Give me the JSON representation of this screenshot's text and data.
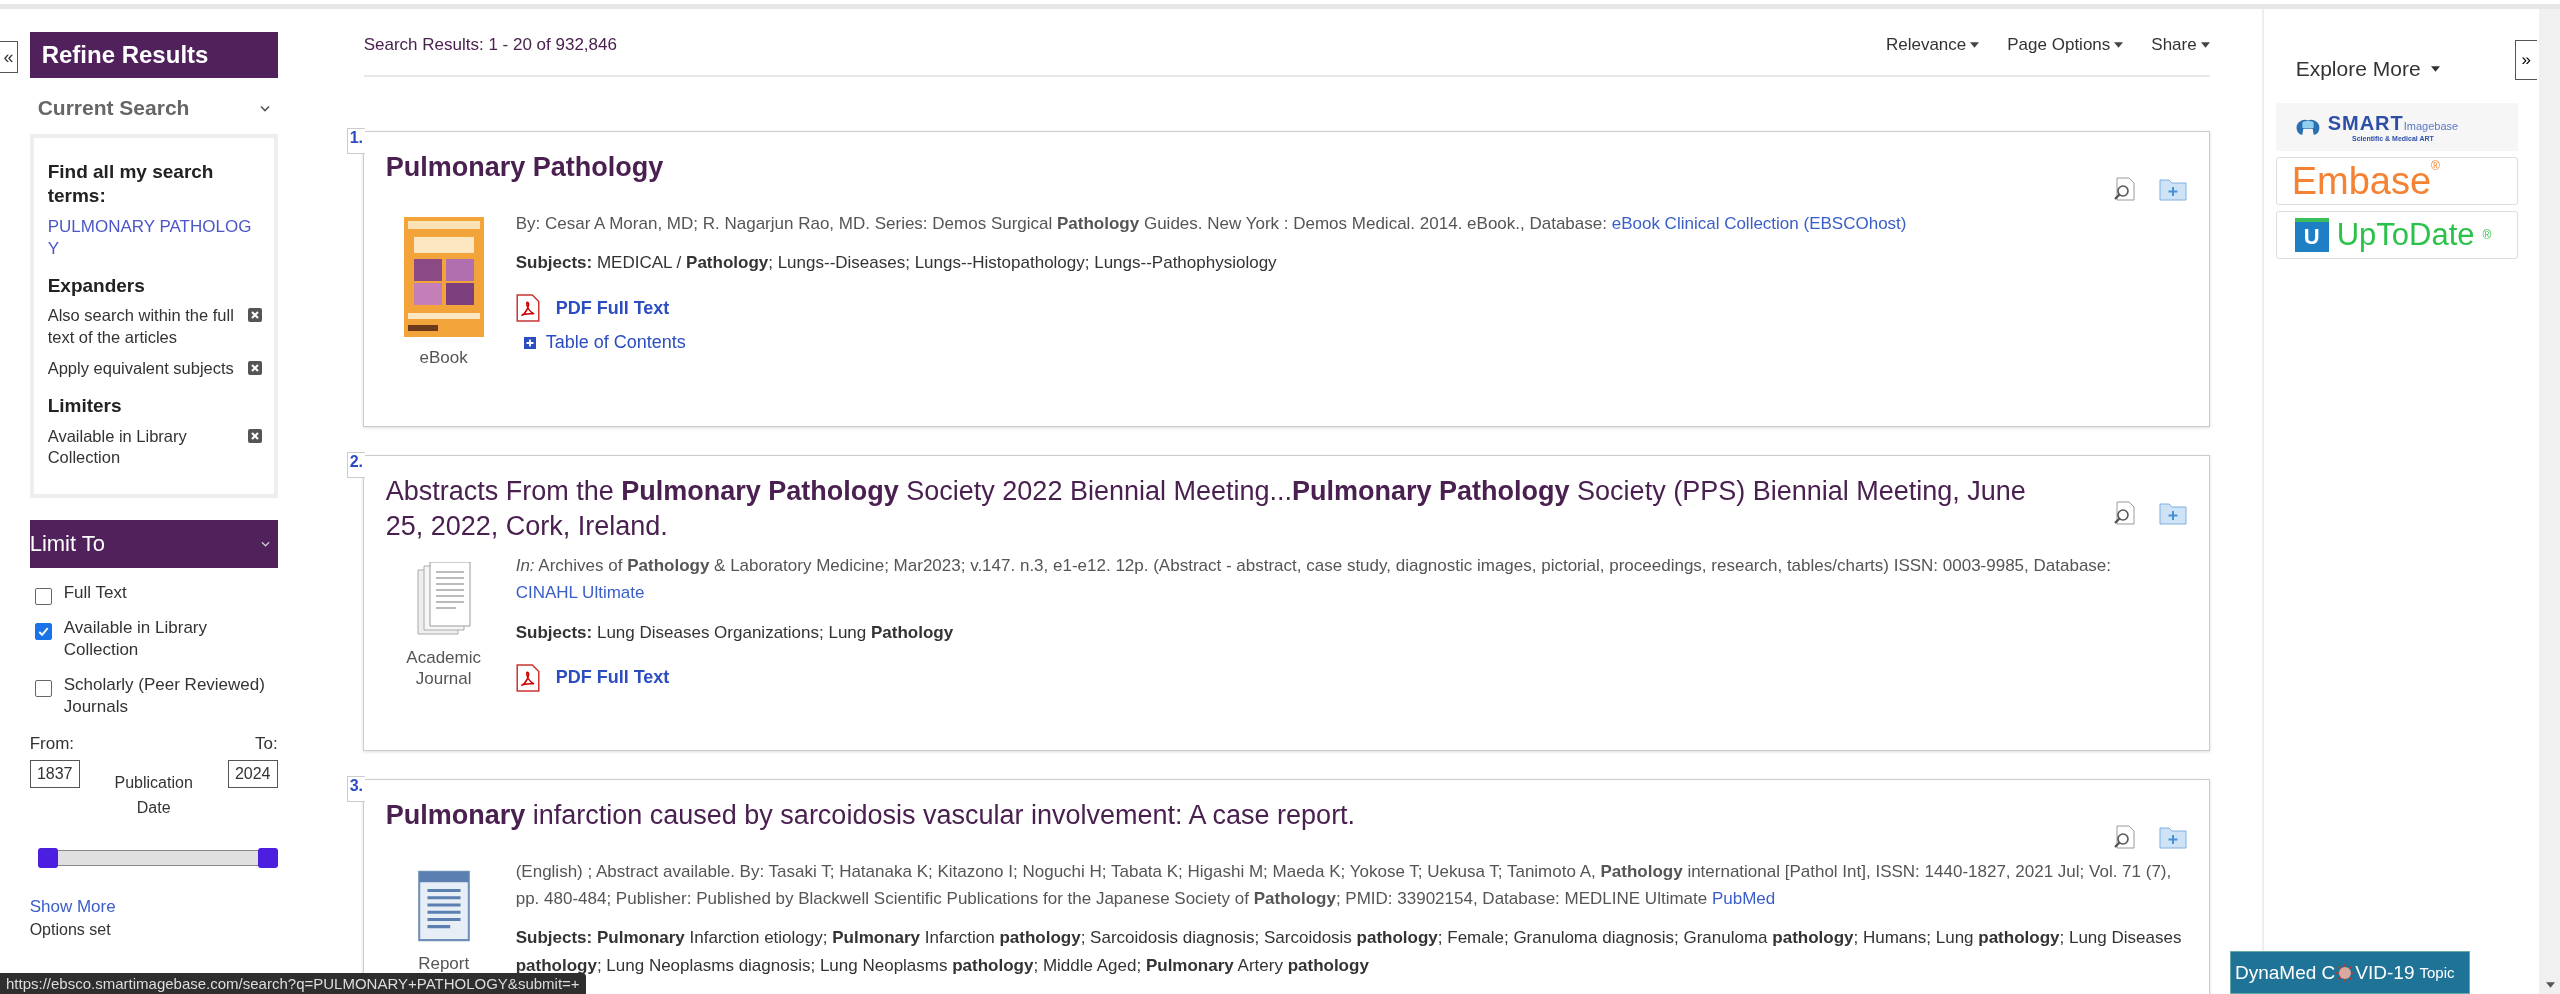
{
  "left_toggle": "«",
  "refine": {
    "title": "Refine Results",
    "current_search": {
      "title": "Current Search",
      "expanded": true,
      "items": [
        {
          "kind": "heading",
          "text": "Find all my search terms:"
        },
        {
          "kind": "term",
          "text": "PULMONARY PATHOLOGY"
        },
        {
          "kind": "heading",
          "text": "Expanders"
        },
        {
          "kind": "removable",
          "text": "Also search within the full text of the articles"
        },
        {
          "kind": "removable",
          "text": "Apply equivalent subjects"
        },
        {
          "kind": "heading",
          "text": "Limiters"
        },
        {
          "kind": "removable",
          "text": "Available in Library Collection"
        }
      ]
    },
    "limit_to": {
      "title": "Limit To",
      "expanded": true,
      "options": [
        {
          "label": "Full Text",
          "checked": false
        },
        {
          "label": "Available in Library Collection",
          "checked": true
        },
        {
          "label": "Scholarly (Peer Reviewed) Journals",
          "checked": false
        }
      ],
      "range": {
        "level": 1
      },
      "from_label": "From:",
      "to_label": "To:",
      "from": "1837",
      "to": "2024",
      "date_label": "Publication Date"
    },
    "show_more": "Show More",
    "options_set": "Options set"
  },
  "results_header": {
    "summary": "Search Results: 1 - 20 of 932,846",
    "menus": [
      "Relevance",
      "Page Options",
      "Share"
    ]
  },
  "results": [
    {
      "number": "1.",
      "title": "Pulmonary Pathology",
      "title_bold": true,
      "kind": "book",
      "type": "eBook",
      "details": "By: Cesar A Moran, MD; R. Nagarjun Rao, MD. Series: Demos Surgical **Pathology** Guides. New York : Demos Medical. 2014. eBook., Database:",
      "database": "eBook Clinical Collection (EBSCOhost)",
      "subjects": "**Subjects:** MEDICAL / **Pathology**; Lungs--Diseases; Lungs--Histopathology; Lungs--Pathophysiology",
      "links": [
        {
          "kind": "pdf",
          "text": "PDF Full Text"
        },
        {
          "kind": "toc",
          "text": "Table of Contents"
        }
      ]
    },
    {
      "number": "2.",
      "title": "Abstracts From the **Pulmonary Pathology** Society 2022 Biennial Meeting...**Pulmonary Pathology** Society (PPS) Biennial Meeting, June 25, 2022, Cork, Ireland.",
      "title_bold": false,
      "kind": "journal",
      "type": "Academic Journal",
      "details": "*In:* Archives of **Pathology** & Laboratory Medicine; Mar2023; v.147. n.3, e1-e12. 12p. (Abstract - abstract, case study, diagnostic images, pictorial, proceedings, research, tables/charts) ISSN: 0003-9985, Database:",
      "database": "CINAHL Ultimate",
      "subjects": "**Subjects:** Lung Diseases Organizations; Lung **Pathology**",
      "links": [
        {
          "kind": "pdf",
          "text": "PDF Full Text"
        }
      ]
    },
    {
      "number": "3.",
      "title": "**Pulmonary** infarction caused by sarcoidosis vascular involvement: A case report.",
      "title_bold": false,
      "kind": "report",
      "type": "Report",
      "details": "(English) ; Abstract available. By: Tasaki T; Hatanaka K; Kitazono I; Noguchi H; Tabata K; Higashi M; Maeda K; Yokose T; Uekusa T; Tanimoto A, **Pathology** international [Pathol Int], ISSN: 1440-1827, 2021 Jul; Vol. 71 (7), pp. 480-484; Publisher: Published by Blackwell Scientific Publications for the Japanese Society of **Pathology**; PMID: 33902154, Database: MEDLINE Ultimate",
      "database": "PubMed",
      "subjects": "**Subjects:** **Pulmonary** Infarction etiology; **Pulmonary** Infarction **pathology**; Sarcoidosis diagnosis; Sarcoidosis **pathology**; Female; Granuloma diagnosis; Granuloma **pathology**; Humans; Lung **pathology**; Lung Diseases **pathology**; Lung Neoplasms diagnosis; Lung Neoplasms **pathology**; Middle Aged; **Pulmonary** Artery **pathology**"
    }
  ],
  "explore": {
    "title": "Explore More",
    "toggle": "»",
    "logos": [
      {
        "kind": "smart",
        "name": "SMART",
        "suffix": "Imagebase",
        "tagline": "Scientific & Medical ART"
      },
      {
        "kind": "embase",
        "name": "Embase",
        "mark": "®"
      },
      {
        "kind": "uptodate",
        "name": "UpToDate",
        "mark": "®",
        "letter": "U"
      }
    ],
    "banner": {
      "before": "DynaMed C",
      "after": "VID-19",
      "tail": "Topic"
    }
  },
  "status_bar": "https://ebsco.smartimagebase.com/search?q=PULMONARY+PATHOLOGY&submit=+"
}
